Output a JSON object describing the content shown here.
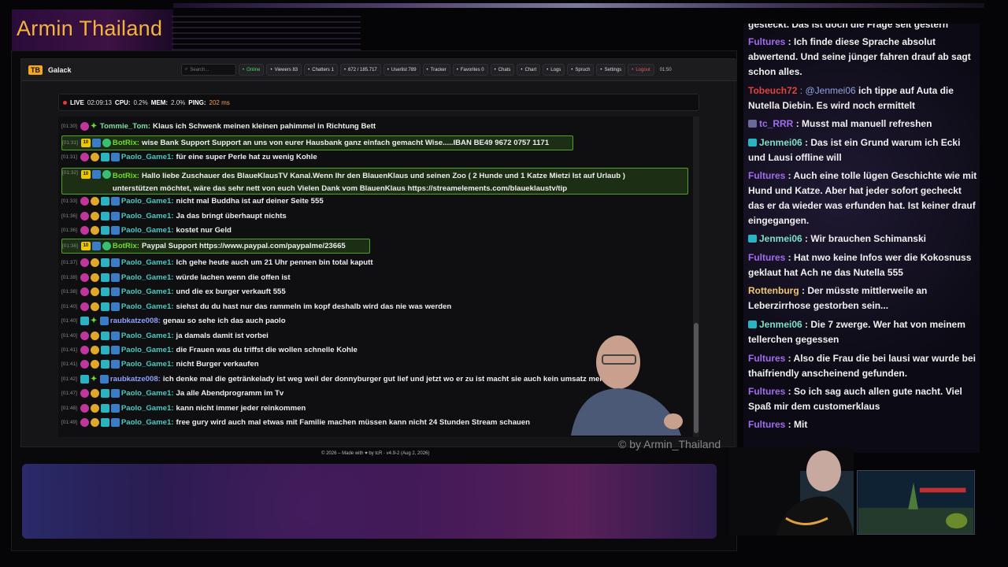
{
  "stream": {
    "title": "Armin Thailand",
    "watermark": "© by Armin_Thailand"
  },
  "app": {
    "name": "Galack",
    "logo": "TB",
    "search_placeholder": "Search...",
    "nav": [
      {
        "icon": "radio-icon",
        "label": "Online"
      },
      {
        "icon": "eye-icon",
        "label": "Viewers 83"
      },
      {
        "icon": "users-icon",
        "label": "Chatters 1"
      },
      {
        "icon": "chat-icon",
        "label": "672 / 185.717"
      },
      {
        "icon": "user-icon",
        "label": "Userlist 789"
      },
      {
        "icon": "target-icon",
        "label": "Tracker"
      },
      {
        "icon": "star-icon",
        "label": "Favorites 0"
      },
      {
        "icon": "history-icon",
        "label": "Chats"
      },
      {
        "icon": "chart-icon",
        "label": "Chart"
      },
      {
        "icon": "log-icon",
        "label": "Logs"
      },
      {
        "icon": "speech-icon",
        "label": "Spruch"
      },
      {
        "icon": "gear-icon",
        "label": "Settings"
      },
      {
        "icon": "logout-icon",
        "label": "Logout"
      }
    ],
    "clock": "01:50",
    "status": {
      "live": "LIVE",
      "uptime": "02:09:13",
      "cpu_label": "CPU:",
      "cpu": "0.2%",
      "mem_label": "MEM:",
      "mem": "2.0%",
      "ping_label": "PING:",
      "ping": "202 ms"
    },
    "footer": "© 2026 – Made with ♥ by tcR · v4.9-2 (Aug 2, 2026)"
  },
  "chat": [
    {
      "ts": "[01:30]",
      "user": "Tommie_Tom:",
      "ucolor": "#7ee0a0",
      "badges": [
        "pink",
        "star"
      ],
      "msg": "Klaus ich Schwenk meinen kleinen pahimmel in Richtung Bett"
    },
    {
      "ts": "[01:31]",
      "user": "BotRix:",
      "ucolor": "#6fdc2c",
      "badges": [
        "ten",
        "vip",
        "green"
      ],
      "msg": "wise Bank Support Support an uns von eurer Hausbank ganz einfach gemacht Wise.....IBAN BE49 9672 0757 1171",
      "hl": true
    },
    {
      "ts": "[01:31]",
      "user": "Paolo_Game1:",
      "ucolor": "#4ec9c0",
      "badges": [
        "pink",
        "gold",
        "teal",
        "vip"
      ],
      "msg": "für eine super Perle hat zu wenig Kohle"
    },
    {
      "ts": "[01:32]",
      "user": "BotRix:",
      "ucolor": "#6fdc2c",
      "badges": [
        "ten",
        "vip",
        "green"
      ],
      "msg": "Hallo liebe Zuschauer des BlaueKlausTV Kanal.Wenn Ihr den BlauenKlaus und seinen Zoo ( 2 Hunde und 1 Katze Mietzi Ist auf Urlaub ) unterstützen möchtet, wäre das sehr nett von euch Vielen Dank vom BlauenKlaus https://streamelements.com/blaueklaustv/tip",
      "hl": true,
      "big": true
    },
    {
      "ts": "[01:33]",
      "user": "Paolo_Game1:",
      "ucolor": "#4ec9c0",
      "badges": [
        "pink",
        "gold",
        "teal",
        "vip"
      ],
      "msg": "nicht mal Buddha ist auf deiner Seite 555"
    },
    {
      "ts": "[01:36]",
      "user": "Paolo_Game1:",
      "ucolor": "#4ec9c0",
      "badges": [
        "pink",
        "gold",
        "teal",
        "vip"
      ],
      "msg": "Ja das bringt überhaupt nichts"
    },
    {
      "ts": "[01:36]",
      "user": "Paolo_Game1:",
      "ucolor": "#4ec9c0",
      "badges": [
        "pink",
        "gold",
        "teal",
        "vip"
      ],
      "msg": "kostet nur Geld"
    },
    {
      "ts": "[01:36]",
      "user": "BotRix:",
      "ucolor": "#6fdc2c",
      "badges": [
        "ten",
        "vip",
        "green"
      ],
      "msg": "Paypal Support https://www.paypal.com/paypalme/23665",
      "hl": true
    },
    {
      "ts": "[01:37]",
      "user": "Paolo_Game1:",
      "ucolor": "#4ec9c0",
      "badges": [
        "pink",
        "gold",
        "teal",
        "vip"
      ],
      "msg": "Ich gehe heute auch um 21 Uhr pennen bin total kaputt"
    },
    {
      "ts": "[01:38]",
      "user": "Paolo_Game1:",
      "ucolor": "#4ec9c0",
      "badges": [
        "pink",
        "gold",
        "teal",
        "vip"
      ],
      "msg": "würde lachen wenn die offen ist"
    },
    {
      "ts": "[01:38]",
      "user": "Paolo_Game1:",
      "ucolor": "#4ec9c0",
      "badges": [
        "pink",
        "gold",
        "teal",
        "vip"
      ],
      "msg": "und die ex burger verkauft 555"
    },
    {
      "ts": "[01:40]",
      "user": "Paolo_Game1:",
      "ucolor": "#4ec9c0",
      "badges": [
        "pink",
        "gold",
        "teal",
        "vip"
      ],
      "msg": "siehst du du hast nur das rammeln im kopf deshalb wird das nie was werden"
    },
    {
      "ts": "[01:40]",
      "user": "raubkatze008:",
      "ucolor": "#8ea0ff",
      "badges": [
        "teal",
        "star",
        "vip"
      ],
      "msg": "genau so sehe ich das auch paolo"
    },
    {
      "ts": "[01:40]",
      "user": "Paolo_Game1:",
      "ucolor": "#4ec9c0",
      "badges": [
        "pink",
        "gold",
        "teal",
        "vip"
      ],
      "msg": "ja damals damit ist vorbei"
    },
    {
      "ts": "[01:41]",
      "user": "Paolo_Game1:",
      "ucolor": "#4ec9c0",
      "badges": [
        "pink",
        "gold",
        "teal",
        "vip"
      ],
      "msg": "die Frauen was du triffst die wollen schnelle Kohle"
    },
    {
      "ts": "[01:41]",
      "user": "Paolo_Game1:",
      "ucolor": "#4ec9c0",
      "badges": [
        "pink",
        "gold",
        "teal",
        "vip"
      ],
      "msg": "nicht Burger verkaufen"
    },
    {
      "ts": "[01:42]",
      "user": "raubkatze008:",
      "ucolor": "#8ea0ff",
      "badges": [
        "teal",
        "star",
        "vip"
      ],
      "msg": "ich denke mal die getränkelady ist weg weil der donnyburger gut lief und jetzt wo er zu ist macht sie auch kein umsatz mehr"
    },
    {
      "ts": "[01:47]",
      "user": "Paolo_Game1:",
      "ucolor": "#4ec9c0",
      "badges": [
        "pink",
        "gold",
        "teal",
        "vip"
      ],
      "msg": "Ja alle Abendprogramm im Tv"
    },
    {
      "ts": "[01:48]",
      "user": "Paolo_Game1:",
      "ucolor": "#4ec9c0",
      "badges": [
        "pink",
        "gold",
        "teal",
        "vip"
      ],
      "msg": "kann nicht immer jeder reinkommen"
    },
    {
      "ts": "[01:49]",
      "user": "Paolo_Game1:",
      "ucolor": "#4ec9c0",
      "badges": [
        "pink",
        "gold",
        "teal",
        "vip"
      ],
      "msg": "free gury wird auch mal etwas mit Familie machen müssen kann nicht 24 Stunden Stream schauen"
    }
  ],
  "side_chat": [
    {
      "name": "",
      "text": "gesteckt. Das ist doch die Frage seit gestern",
      "cls": "",
      "badge": ""
    },
    {
      "name": "Fultures",
      "text": ": Ich finde diese Sprache absolut abwertend. Und seine jünger fahren drauf ab sagt schon alles.",
      "cls": "",
      "badge": ""
    },
    {
      "name": "Tobeuch72",
      "mention": "@Jenmei06",
      "text": "ich tippe auf Auta die Nutella Diebin. Es wird noch ermittelt",
      "cls": "red",
      "badge": ""
    },
    {
      "name": "tc_RRR",
      "text": ": Musst mal manuell refreshen",
      "cls": "",
      "badge": "s"
    },
    {
      "name": "Jenmei06",
      "text": ": Das ist ein Grund warum ich Ecki und Lausi offline will",
      "cls": "teal",
      "badge": "t"
    },
    {
      "name": "Fultures",
      "text": ": Auch eine tolle lügen Geschichte wie mit Hund und Katze. Aber hat jeder sofort gecheckt das er da wieder was erfunden hat. Ist keiner drauf eingegangen.",
      "cls": "",
      "badge": ""
    },
    {
      "name": "Jenmei06",
      "text": ": Wir brauchen Schimanski",
      "cls": "teal",
      "badge": "t"
    },
    {
      "name": "Fultures",
      "text": ": Hat nwo keine Infos wer die Kokosnuss geklaut hat Ach ne das Nutella 555",
      "cls": "",
      "badge": ""
    },
    {
      "name": "Rottenburg",
      "text": ": Der müsste mittlerweile an Leberzirrhose gestorben sein...",
      "cls": "gold",
      "badge": ""
    },
    {
      "name": "Jenmei06",
      "text": ": Die 7 zwerge. Wer hat von meinem tellerchen gegessen",
      "cls": "teal",
      "badge": "t"
    },
    {
      "name": "Fultures",
      "text": ": Also die Frau die bei lausi war wurde bei thaifriendly anscheinend gefunden.",
      "cls": "",
      "badge": ""
    },
    {
      "name": "Fultures",
      "text": ": So ich sag auch allen gute nacht. Viel Spaß mir dem customerklaus",
      "cls": "",
      "badge": ""
    },
    {
      "name": "Fultures",
      "text": ": Mit",
      "cls": "",
      "badge": ""
    }
  ]
}
